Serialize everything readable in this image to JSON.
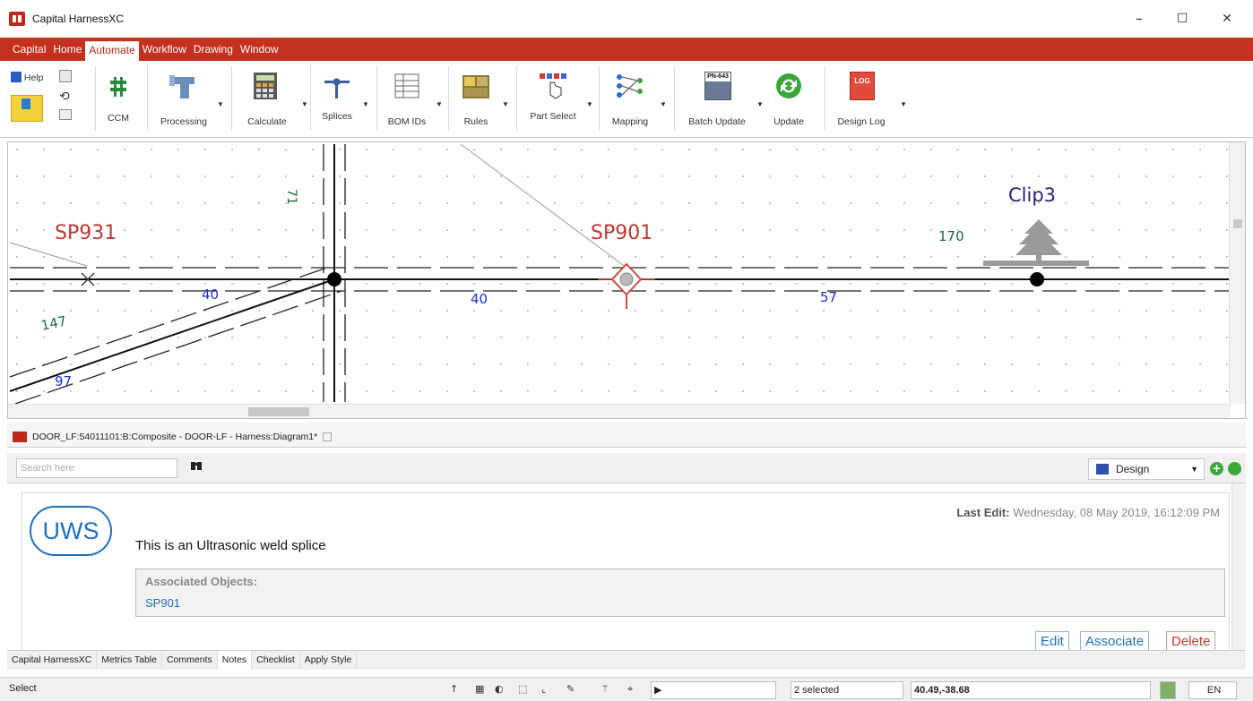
{
  "window": {
    "title": "Capital HarnessXC",
    "minimize": "–",
    "maximize": "☐",
    "close": "✕"
  },
  "menu": {
    "tabs": [
      "Capital",
      "Home",
      "Automate",
      "Workflow",
      "Drawing",
      "Window"
    ],
    "active": "Automate"
  },
  "ribbon": {
    "help": "Help",
    "ccm": "CCM",
    "processing": "Processing",
    "calculate": "Calculate",
    "splices": "Splices",
    "bom_ids": "BOM IDs",
    "rules": "Rules",
    "part_select": "Part Select",
    "mapping": "Mapping",
    "batch_update": "Batch Update",
    "batch_icon_text": "PN-643",
    "update": "Update",
    "design_log": "Design Log",
    "log_icon_text": "LOG"
  },
  "canvas": {
    "labels": {
      "sp931": "SP931",
      "sp901": "SP901",
      "clip3": "Clip3",
      "n71": "71",
      "n170": "170",
      "n40a": "40",
      "n40b": "40",
      "n57": "57",
      "n147": "147",
      "n97": "97"
    }
  },
  "doc_tab": {
    "label": "DOOR_LF:54011101:B:Composite - DOOR-LF - Harness:Diagram1*"
  },
  "notes": {
    "search_placeholder": "Search here",
    "design_value": "Design",
    "add_icon": "+",
    "avatar_text": "UWS",
    "last_edit_label": "Last Edit:",
    "last_edit_value": "Wednesday, 08 May 2019, 16:12:09 PM",
    "text": "This is an Ultrasonic weld splice",
    "assoc_label": "Associated Objects:",
    "assoc_item": "SP901",
    "edit": "Edit",
    "associate": "Associate",
    "delete": "Delete"
  },
  "bottom_tabs": [
    "Capital HarnessXC",
    "Metrics Table",
    "Comments",
    "Notes",
    "Checklist",
    "Apply Style"
  ],
  "bottom_tab_active": "Notes",
  "status": {
    "mode": "Select",
    "selected": "2 selected",
    "coords": "40.49,-38.68",
    "lang": "EN"
  },
  "colors": {
    "brand_red": "#c5311f",
    "label_red": "#b83a32",
    "dim_blue": "#1a2fd0",
    "dim_green": "#1c6a3a",
    "clip_navy": "#22247a",
    "link_blue": "#1f6fc6"
  }
}
